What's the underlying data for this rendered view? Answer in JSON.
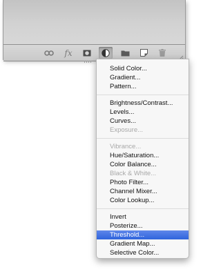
{
  "panel": {
    "footer_icons": [
      {
        "name": "link-layers-icon"
      },
      {
        "name": "fx-effects-icon",
        "glyph": "fx"
      },
      {
        "name": "add-mask-icon"
      },
      {
        "name": "adjustment-layer-icon"
      },
      {
        "name": "new-group-folder-icon"
      },
      {
        "name": "new-layer-icon"
      },
      {
        "name": "trash-icon"
      }
    ],
    "active_icon": "adjustment-layer-icon"
  },
  "menu": {
    "group1": [
      "Solid Color...",
      "Gradient...",
      "Pattern..."
    ],
    "group2": [
      "Brightness/Contrast...",
      "Levels...",
      "Curves...",
      "Exposure..."
    ],
    "group3": [
      "Vibrance...",
      "Hue/Saturation...",
      "Color Balance...",
      "Black & White...",
      "Photo Filter...",
      "Channel Mixer...",
      "Color Lookup..."
    ],
    "group4": [
      "Invert",
      "Posterize...",
      "Threshold...",
      "Gradient Map...",
      "Selective Color..."
    ],
    "disabled": [
      "Exposure...",
      "Vibrance...",
      "Black & White..."
    ],
    "highlighted": "Threshold..."
  },
  "colors": {
    "highlight": "#3b6de3",
    "disabled_text": "#a8a8a8"
  }
}
